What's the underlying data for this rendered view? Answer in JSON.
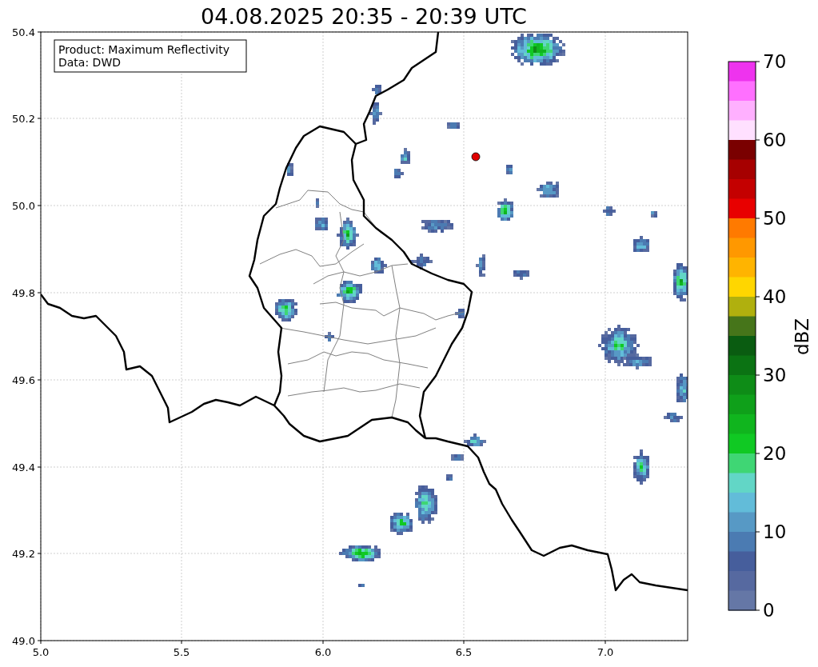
{
  "title": "04.08.2025 20:35 - 20:39 UTC",
  "info_box": [
    "Product: Maximum Reflectivity",
    "Data: DWD"
  ],
  "x_ticks": [
    "5.0",
    "5.5",
    "6.0",
    "6.5",
    "7.0"
  ],
  "y_ticks": [
    "50.4",
    "50.2",
    "50.0",
    "49.8",
    "49.6",
    "49.4",
    "49.2",
    "49.0"
  ],
  "colorbar": {
    "label": "dBZ",
    "ticks": [
      "70",
      "60",
      "50",
      "40",
      "30",
      "20",
      "10",
      "0"
    ],
    "bins": [
      {
        "color": "#ee33ee"
      },
      {
        "color": "#ff70ff"
      },
      {
        "color": "#ffb0ff"
      },
      {
        "color": "#ffe0ff"
      },
      {
        "color": "#7a0000"
      },
      {
        "color": "#a60000"
      },
      {
        "color": "#c40000"
      },
      {
        "color": "#e80000"
      },
      {
        "color": "#ff7a00"
      },
      {
        "color": "#ff9800"
      },
      {
        "color": "#ffb400"
      },
      {
        "color": "#ffd600"
      },
      {
        "color": "#b0b00e"
      },
      {
        "color": "#46751a"
      },
      {
        "color": "#0a5c11"
      },
      {
        "color": "#0b7313"
      },
      {
        "color": "#0e8c17"
      },
      {
        "color": "#0fa01a"
      },
      {
        "color": "#10b51e"
      },
      {
        "color": "#10c923"
      },
      {
        "color": "#3fd674"
      },
      {
        "color": "#62d6c6"
      },
      {
        "color": "#62bcd9"
      },
      {
        "color": "#5799c5"
      },
      {
        "color": "#4b7bb2"
      },
      {
        "color": "#465e9c"
      },
      {
        "color": "#5669a0"
      },
      {
        "color": "#6577a6"
      }
    ]
  }
}
